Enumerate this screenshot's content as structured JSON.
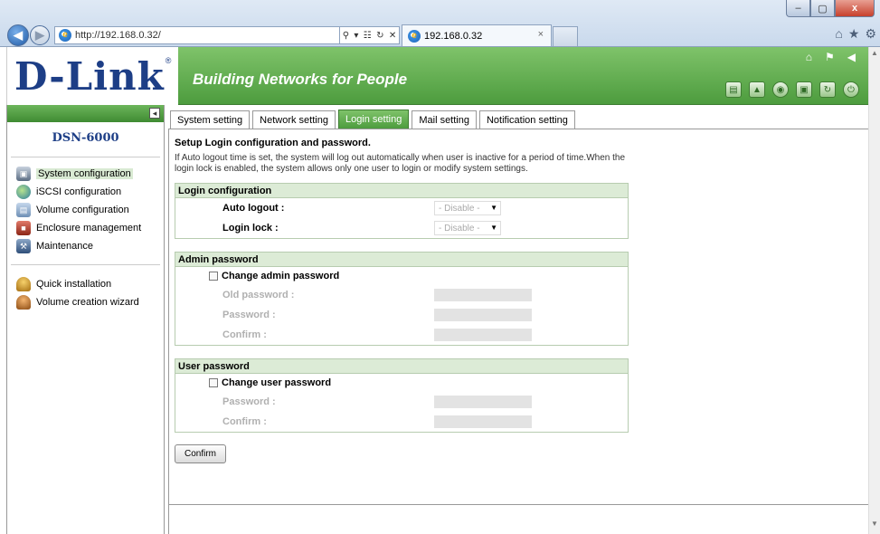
{
  "browser": {
    "url": "http://192.168.0.32/",
    "tab_title": "192.168.0.32",
    "tab_close": "×",
    "window_controls": [
      "–",
      "▢",
      "x"
    ]
  },
  "header": {
    "logo": "D-Link",
    "logo_mark": "®",
    "slogan": "Building Networks for People"
  },
  "sidebar": {
    "model": "DSN-6000",
    "items": [
      {
        "label": "System configuration",
        "icon": "system-config-icon"
      },
      {
        "label": "iSCSI configuration",
        "icon": "iscsi-icon"
      },
      {
        "label": "Volume configuration",
        "icon": "volume-icon"
      },
      {
        "label": "Enclosure management",
        "icon": "enclosure-icon"
      },
      {
        "label": "Maintenance",
        "icon": "maintenance-icon"
      }
    ],
    "quick_items": [
      {
        "label": "Quick installation",
        "icon": "quick-install-icon"
      },
      {
        "label": "Volume creation wizard",
        "icon": "wizard-icon"
      }
    ]
  },
  "tabs": [
    "System setting",
    "Network setting",
    "Login setting",
    "Mail setting",
    "Notification setting"
  ],
  "active_tab": "Login setting",
  "content": {
    "heading": "Setup Login configuration and password.",
    "description": "If Auto logout time is set, the system will log out automatically when user is inactive for a period of time.When the login lock is enabled, the system allows only one user to login or modify system settings.",
    "login_config": {
      "title": "Login configuration",
      "auto_logout_label": "Auto logout :",
      "auto_logout_value": "- Disable -",
      "login_lock_label": "Login lock :",
      "login_lock_value": "- Disable -"
    },
    "admin_password": {
      "title": "Admin password",
      "change_label": "Change admin password",
      "old_password_label": "Old password :",
      "password_label": "Password :",
      "confirm_label": "Confirm :"
    },
    "user_password": {
      "title": "User password",
      "change_label": "Change user password",
      "password_label": "Password :",
      "confirm_label": "Confirm :"
    },
    "confirm_button": "Confirm"
  },
  "colors": {
    "brand_blue": "#1d3e86",
    "banner_green": "#4d9c3e",
    "section_header": "#dcebd6"
  }
}
